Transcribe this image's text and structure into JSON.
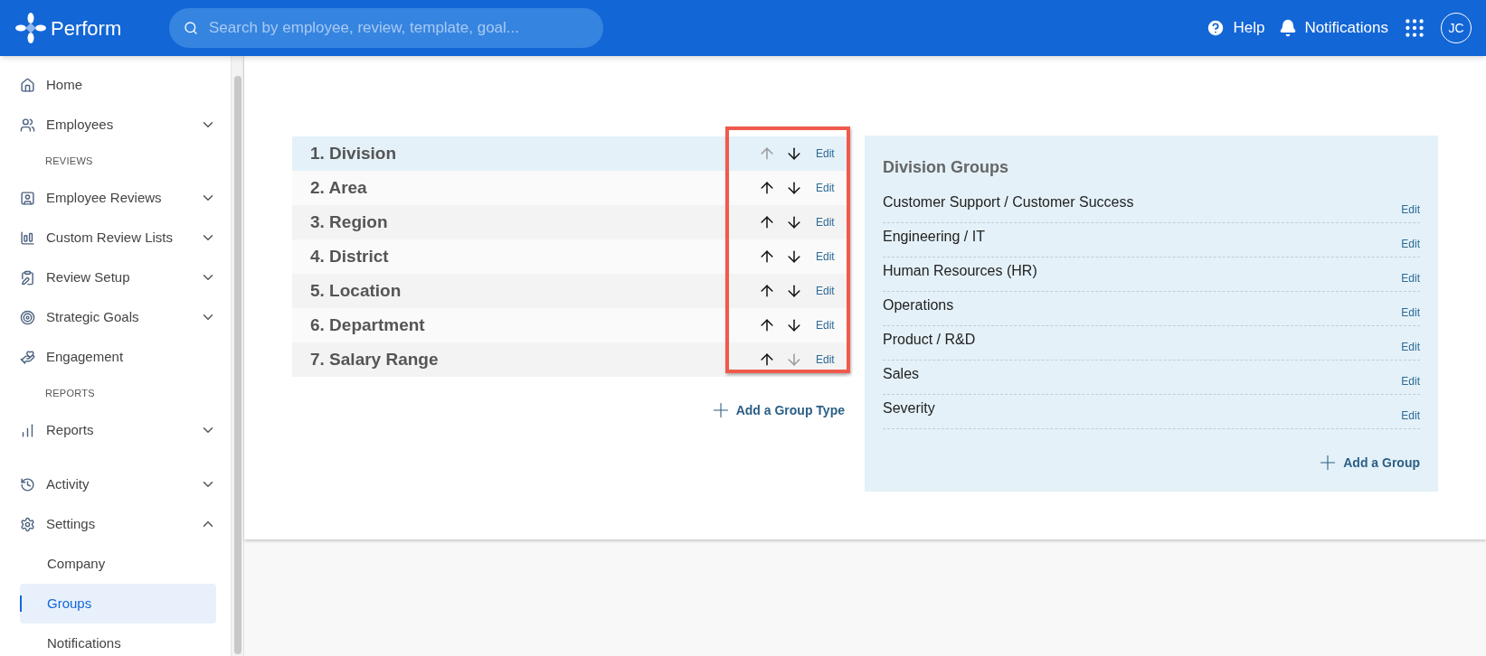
{
  "header": {
    "logo_text": "Perform",
    "search": {
      "placeholder": "Search by employee, review, template, goal..."
    },
    "help": "Help",
    "notifications": "Notifications",
    "avatar": "JC"
  },
  "sidebar": {
    "items": [
      {
        "kind": "item",
        "label": "Home"
      },
      {
        "kind": "item",
        "label": "Employees",
        "expanded": false
      },
      {
        "kind": "section",
        "label": "REVIEWS"
      },
      {
        "kind": "item",
        "label": "Employee Reviews",
        "expanded": false
      },
      {
        "kind": "item",
        "label": "Custom Review Lists",
        "expanded": false
      },
      {
        "kind": "item",
        "label": "Review Setup",
        "expanded": false
      },
      {
        "kind": "item",
        "label": "Strategic Goals",
        "expanded": false
      },
      {
        "kind": "item",
        "label": "Engagement"
      },
      {
        "kind": "section",
        "label": "REPORTS"
      },
      {
        "kind": "item",
        "label": "Reports",
        "expanded": false
      },
      {
        "kind": "item",
        "label": "Activity",
        "expanded": false
      },
      {
        "kind": "item",
        "label": "Settings",
        "expanded": true
      },
      {
        "kind": "subitem",
        "label": "Company",
        "selected": false
      },
      {
        "kind": "subitem",
        "label": "Groups",
        "selected": true
      },
      {
        "kind": "subitem",
        "label": "Notifications",
        "selected": false
      }
    ]
  },
  "group_types": {
    "highlighted": true,
    "rows": [
      {
        "name": "1. Division",
        "selected": true,
        "up_enabled": false,
        "down_enabled": true,
        "edit": "Edit"
      },
      {
        "name": "2. Area",
        "selected": false,
        "up_enabled": true,
        "down_enabled": true,
        "edit": "Edit"
      },
      {
        "name": "3. Region",
        "selected": false,
        "up_enabled": true,
        "down_enabled": true,
        "edit": "Edit"
      },
      {
        "name": "4. District",
        "selected": false,
        "up_enabled": true,
        "down_enabled": true,
        "edit": "Edit"
      },
      {
        "name": "5. Location",
        "selected": false,
        "up_enabled": true,
        "down_enabled": true,
        "edit": "Edit"
      },
      {
        "name": "6. Department",
        "selected": false,
        "up_enabled": true,
        "down_enabled": true,
        "edit": "Edit"
      },
      {
        "name": "7. Salary Range",
        "selected": false,
        "up_enabled": true,
        "down_enabled": false,
        "edit": "Edit"
      }
    ],
    "add_button": "Add a Group Type"
  },
  "groups_panel": {
    "title": "Division Groups",
    "groups": [
      {
        "name": "Customer Support / Customer Success",
        "edit": "Edit"
      },
      {
        "name": "Engineering / IT",
        "edit": "Edit"
      },
      {
        "name": "Human Resources (HR)",
        "edit": "Edit"
      },
      {
        "name": "Operations",
        "edit": "Edit"
      },
      {
        "name": "Product / R&D",
        "edit": "Edit"
      },
      {
        "name": "Sales",
        "edit": "Edit"
      },
      {
        "name": "Severity",
        "edit": "Edit"
      }
    ],
    "add_button": "Add a Group"
  }
}
